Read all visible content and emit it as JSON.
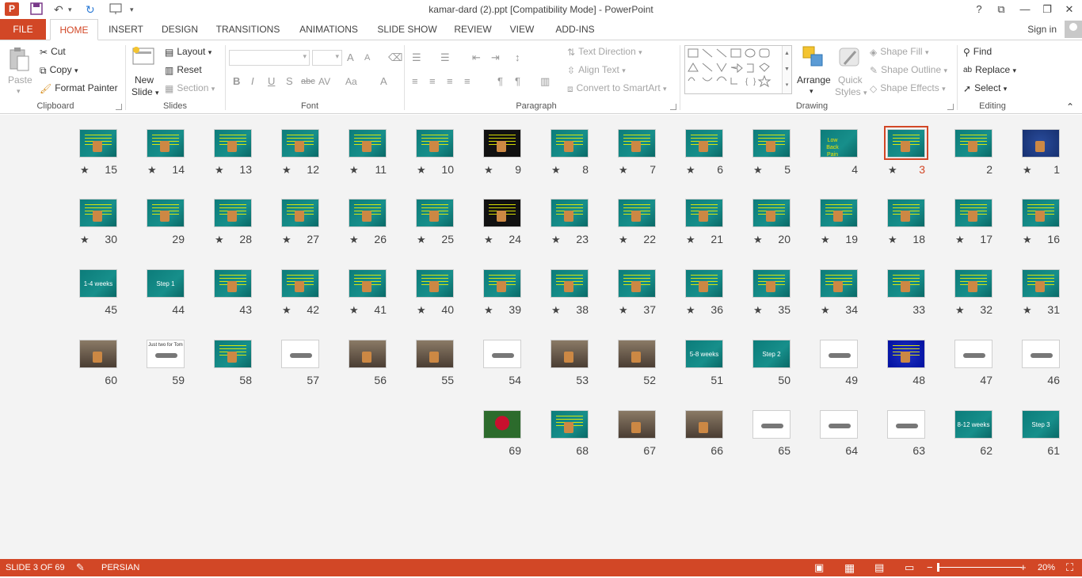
{
  "titlebar": {
    "title": "kamar-dard (2).ppt [Compatibility Mode] - PowerPoint",
    "help": "?",
    "restore": "⧉",
    "minimize": "—",
    "maximize": "❐",
    "close": "✕"
  },
  "tabs": {
    "file": "FILE",
    "items": [
      "HOME",
      "INSERT",
      "DESIGN",
      "TRANSITIONS",
      "ANIMATIONS",
      "SLIDE SHOW",
      "REVIEW",
      "VIEW",
      "ADD-INS"
    ],
    "signin": "Sign in"
  },
  "ribbon": {
    "clipboard": {
      "paste": "Paste",
      "cut": "Cut",
      "copy": "Copy",
      "format_painter": "Format Painter",
      "label": "Clipboard"
    },
    "slides": {
      "new_slide": "New",
      "new_slide2": "Slide",
      "layout": "Layout",
      "reset": "Reset",
      "section": "Section",
      "label": "Slides"
    },
    "font": {
      "label": "Font",
      "bold": "B",
      "italic": "I",
      "underline": "U",
      "shadow": "S",
      "strike": "abc",
      "spacing": "AV",
      "case": "Aa",
      "color": "A",
      "grow": "A",
      "shrink": "A"
    },
    "paragraph": {
      "text_direction": "Text Direction",
      "align_text": "Align Text",
      "smartart": "Convert to SmartArt",
      "label": "Paragraph"
    },
    "drawing": {
      "arrange": "Arrange",
      "quick": "Quick",
      "styles": "Styles",
      "shape_fill": "Shape Fill",
      "shape_outline": "Shape Outline",
      "shape_effects": "Shape Effects",
      "label": "Drawing"
    },
    "editing": {
      "find": "Find",
      "replace": "Replace",
      "select": "Select",
      "label": "Editing"
    }
  },
  "slides": {
    "row1": [
      "15",
      "14",
      "13",
      "12",
      "11",
      "10",
      "9",
      "8",
      "7",
      "6",
      "5",
      "4",
      "3",
      "2",
      "1"
    ],
    "row2": [
      "30",
      "29",
      "28",
      "27",
      "26",
      "25",
      "24",
      "23",
      "22",
      "21",
      "20",
      "19",
      "18",
      "17",
      "16"
    ],
    "row3": [
      "45",
      "44",
      "43",
      "42",
      "41",
      "40",
      "39",
      "38",
      "37",
      "36",
      "35",
      "34",
      "33",
      "32",
      "31"
    ],
    "row4": [
      "60",
      "59",
      "58",
      "57",
      "56",
      "55",
      "54",
      "53",
      "52",
      "51",
      "50",
      "49",
      "48",
      "47",
      "46"
    ],
    "row5": [
      "69",
      "68",
      "67",
      "66",
      "65",
      "64",
      "63",
      "62",
      "61"
    ],
    "labels": {
      "s4": "Low Back Pain",
      "s44": "Step 1",
      "s45": "1-4 weeks",
      "s50": "Step 2",
      "s51": "5-8 weeks",
      "s61": "Step 3",
      "s62": "8-12 weeks",
      "s59": "Just two",
      "s59b": "for Tom"
    },
    "star": "★"
  },
  "status": {
    "slide_info": "SLIDE 3 OF 69",
    "language": "PERSIAN",
    "zoom": "20%",
    "minus": "−",
    "plus": "+"
  },
  "colors": {
    "accent": "#d24726",
    "slide_bg": "#0c7c7a"
  }
}
